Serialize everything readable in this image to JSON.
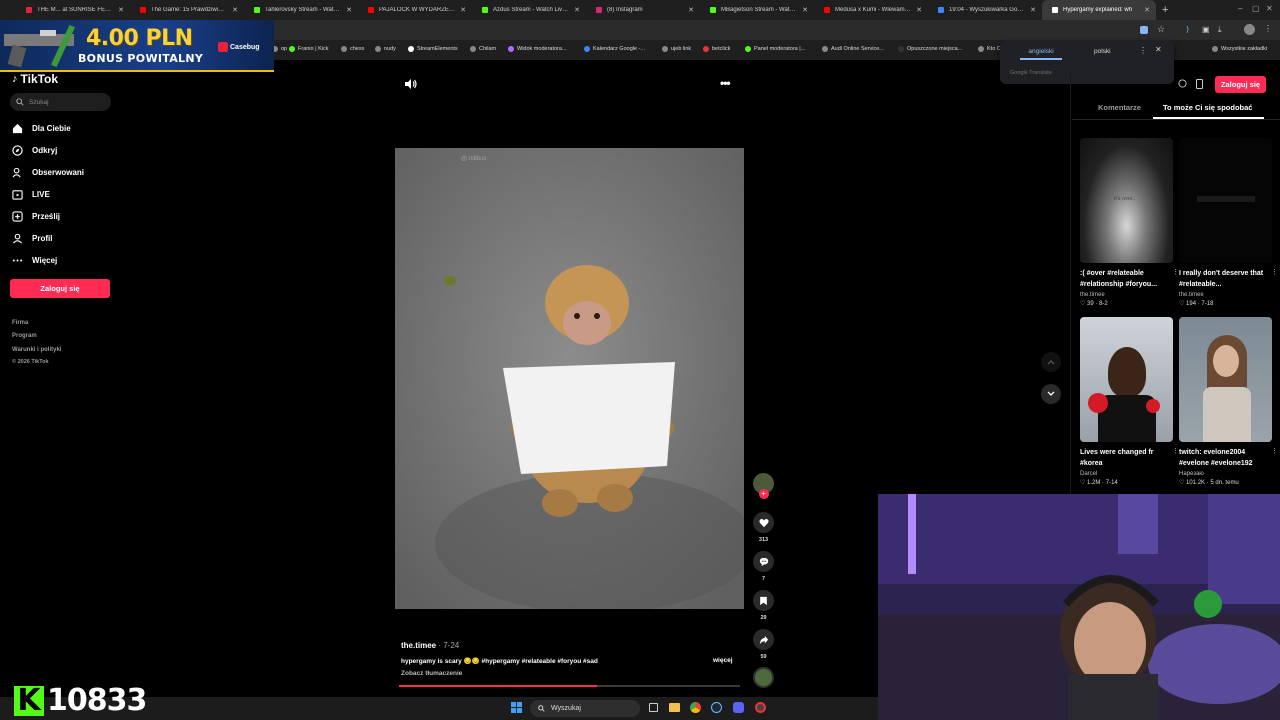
{
  "browser": {
    "tabs": [
      {
        "title": "THE M... at SUNRISE FESTIV",
        "color": "#e8213d"
      },
      {
        "title": "The Game: 15 Prawdziwiaków w",
        "color": "#ff0000"
      },
      {
        "title": "Tahlerovsky Stream - Watch L",
        "color": "#53fc18"
      },
      {
        "title": "PAJALOCK W WYDARZENIACH",
        "color": "#ff0000"
      },
      {
        "title": "Azdus Stream - Watch Live o",
        "color": "#53fc18"
      },
      {
        "title": "(8) Instagram",
        "color": "#d62976"
      },
      {
        "title": "MBagietson Stream - Watch L",
        "color": "#53fc18"
      },
      {
        "title": "Medusa x Kumi - Wlewam do",
        "color": "#ff0000"
      },
      {
        "title": "19:04 - Wyszukiwarka Google",
        "color": "#4285f4"
      },
      {
        "title": "Hypergamy explained: wh",
        "color": "#ffffff",
        "active": true
      }
    ],
    "new_tab": "+",
    "window_controls": [
      "–",
      "▢",
      "✕"
    ],
    "bookmarks": [
      "op",
      "Franio | Kick",
      "chess",
      "nudy",
      "StreamElements",
      "Chilam",
      "Widok moderatora...",
      "Kalendarz Google -...",
      "ujeb link",
      "betclick",
      "Panel moderatora |...",
      "Audi Online Service...",
      "Opuszczone miejsca...",
      "Kto Ci",
      "Wszystkie zakładki"
    ]
  },
  "ad": {
    "amount": "4.00 PLN",
    "bonus": "BONUS POWITALNY",
    "brand": "Casebug"
  },
  "translate_popup": {
    "lang_from": "angielski",
    "lang_to": "polski",
    "footer": "Google Translate"
  },
  "sidebar": {
    "logo": "TikTok",
    "search_placeholder": "Szukaj",
    "nav": [
      {
        "label": "Dla Ciebie",
        "icon": "home-icon"
      },
      {
        "label": "Odkryj",
        "icon": "compass-icon"
      },
      {
        "label": "Obserwowani",
        "icon": "following-icon"
      },
      {
        "label": "LIVE",
        "icon": "live-icon"
      },
      {
        "label": "Prześlij",
        "icon": "upload-icon"
      },
      {
        "label": "Profil",
        "icon": "profile-icon"
      },
      {
        "label": "Więcej",
        "icon": "more-icon"
      }
    ],
    "login": "Zaloguj się",
    "footer": [
      "Firma",
      "Program",
      "Warunki i polityki",
      "© 2026 TikTok"
    ]
  },
  "video": {
    "author": "the.timee",
    "date": "7-24",
    "caption": "hypergamy is scary 😔😔 #hypergamy #relateable #foryou #sad",
    "more": "więcej",
    "see_translation": "Zobacz tłumaczenie",
    "watermark": "@.mitbus",
    "progress": 0.58,
    "likes": "313",
    "comments": "7",
    "saves": "29",
    "shares": "59"
  },
  "right_panel": {
    "login": "Zaloguj się",
    "tab_comments": "Komentarze",
    "tab_suggested": "To może Ci się spodobać",
    "cards": [
      {
        "title": ":( #over #relateable #relationship #foryou...",
        "author": "the.timee",
        "likes": "39",
        "date": "8-2",
        "overlay": "it's over.."
      },
      {
        "title": "I really don't deserve that #relateable...",
        "author": "the.timee",
        "likes": "194",
        "date": "7-18",
        "overlay": ""
      },
      {
        "title": "Lives were changed fr #korea",
        "author": "Darcel",
        "likes": "1.2M",
        "date": "7-14",
        "overlay": ""
      },
      {
        "title": "twitch: evelone2004 #evelone #evelone192",
        "author": "Нарезаю",
        "likes": "101.2K",
        "date": "5 dn. temu",
        "overlay": ""
      }
    ]
  },
  "taskbar": {
    "search": "Wyszukaj"
  },
  "kick_overlay": {
    "count": "10833"
  }
}
